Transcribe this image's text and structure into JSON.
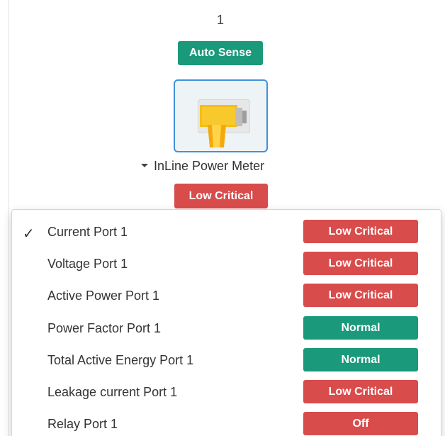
{
  "port": {
    "number": "1",
    "mode_badge": "Auto Sense"
  },
  "device": {
    "name": "InLine Power Meter",
    "status": "Low Critical",
    "icon": "inline-power-meter-icon"
  },
  "sensors": [
    {
      "label": "Current Port 1",
      "status": "Low Critical",
      "checked": true
    },
    {
      "label": "Voltage Port 1",
      "status": "Low Critical",
      "checked": false
    },
    {
      "label": "Active Power Port 1",
      "status": "Low Critical",
      "checked": false
    },
    {
      "label": "Power Factor Port 1",
      "status": "Normal",
      "checked": false
    },
    {
      "label": "Total Active Energy Port 1",
      "status": "Normal",
      "checked": false
    },
    {
      "label": "Leakage current Port 1",
      "status": "Low Critical",
      "checked": false
    },
    {
      "label": "Relay Port 1",
      "status": "Off",
      "checked": false
    }
  ],
  "colors": {
    "critical": "#d94c4c",
    "normal": "#1a9a7a",
    "selected_border": "#3f92db"
  }
}
